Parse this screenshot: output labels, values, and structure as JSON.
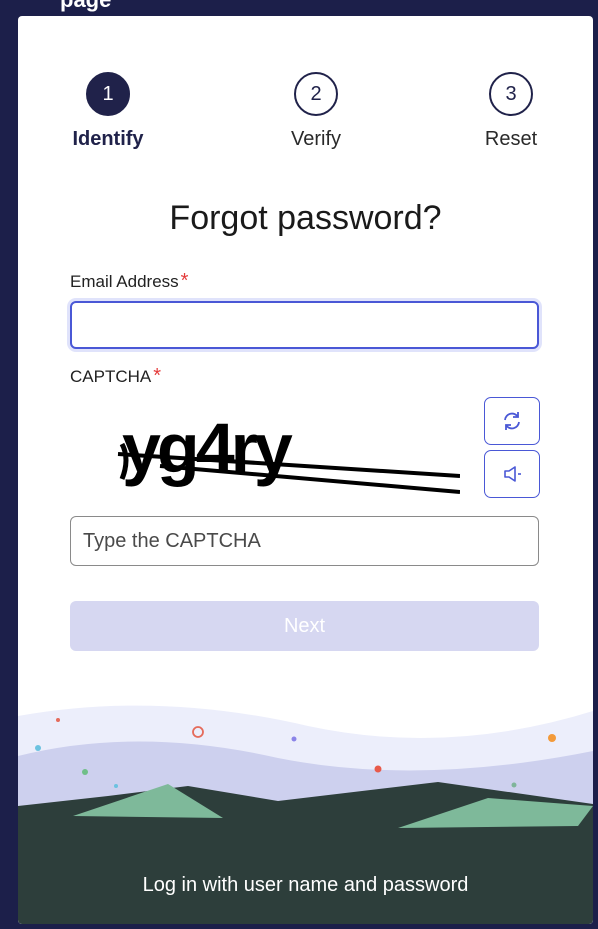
{
  "header_fragment": "page",
  "stepper": [
    {
      "number": "1",
      "label": "Identify",
      "active": true
    },
    {
      "number": "2",
      "label": "Verify",
      "active": false
    },
    {
      "number": "3",
      "label": "Reset",
      "active": false
    }
  ],
  "title": "Forgot password?",
  "email": {
    "label": "Email Address",
    "required_mark": "*",
    "value": ""
  },
  "captcha": {
    "label": "CAPTCHA",
    "required_mark": "*",
    "image_text": "yg4ry",
    "refresh_icon": "refresh-icon",
    "audio_icon": "speaker-icon",
    "input_placeholder": "Type the CAPTCHA"
  },
  "next_button": "Next",
  "footer_link": "Log in with user name and password",
  "colors": {
    "primary": "#20224a",
    "accent": "#4a58d6",
    "required": "#e43b3b",
    "disabled_button": "#d6d7f1",
    "footer_bg": "#2d3e3b"
  }
}
